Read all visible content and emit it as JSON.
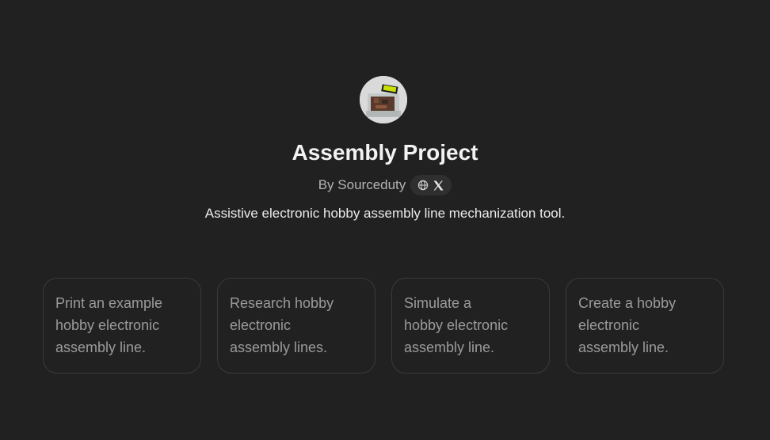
{
  "gpt": {
    "name": "Assembly Project",
    "author": "By Sourceduty",
    "description": "Assistive electronic hobby assembly line mechanization tool.",
    "social_icons": [
      "globe-icon",
      "x-logo-icon"
    ]
  },
  "conversation_starters": [
    {
      "lines": [
        "Print an example",
        "hobby electronic",
        "assembly line."
      ]
    },
    {
      "lines": [
        "Research hobby",
        "electronic",
        "assembly lines."
      ]
    },
    {
      "lines": [
        "Simulate a",
        "hobby electronic",
        "assembly line."
      ]
    },
    {
      "lines": [
        "Create a hobby",
        "electronic",
        "assembly line."
      ]
    }
  ],
  "colors": {
    "background": "#212121",
    "card_border": "#3a3a3a",
    "card_text": "#9b9b9b",
    "badge_bg": "#2f2f2f"
  }
}
